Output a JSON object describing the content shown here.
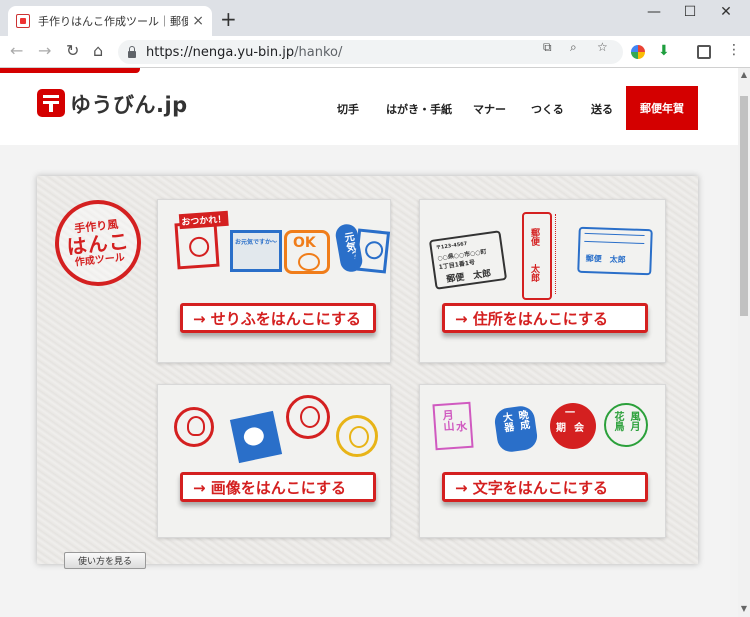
{
  "browser": {
    "tab_title": "手作りはんこ作成ツール｜郵便年",
    "tab_close": "×",
    "new_tab": "+",
    "window_controls": [
      "—",
      "☐",
      "✕"
    ],
    "url_host": "https://nenga.yu-bin.jp",
    "url_path": "/hanko/",
    "nav_icons": [
      "arrow-left-icon",
      "arrow-right-icon",
      "reload-icon",
      "home-icon"
    ]
  },
  "site": {
    "logo_text": "ゆうびん.jp",
    "nav": [
      "切手",
      "はがき・手紙",
      "マナー",
      "つくる",
      "送る"
    ],
    "nav_highlight": "郵便年賀",
    "brand_color": "#d40000"
  },
  "badge": {
    "line1": "手作り風",
    "line2": "はんこ",
    "line3": "作成ツール"
  },
  "cards": [
    {
      "label": "→ せりふをはんこにする",
      "stamps": [
        "おつかれ！",
        "お元気ですか～",
        "OK",
        "元気？"
      ]
    },
    {
      "label": "→ 住所をはんこにする",
      "stamps": [
        "〒123-4567",
        "○○県○○市○○町",
        "1丁目1番1号",
        "郵便　太郎"
      ]
    },
    {
      "label": "→ 画像をはんこにする",
      "stamps": []
    },
    {
      "label": "→ 文字をはんこにする",
      "stamps": [
        "月山",
        "水",
        "大器",
        "晩成",
        "一",
        "期",
        "会",
        "花鳥",
        "風月"
      ]
    }
  ],
  "howto_button": "使い方を見る"
}
